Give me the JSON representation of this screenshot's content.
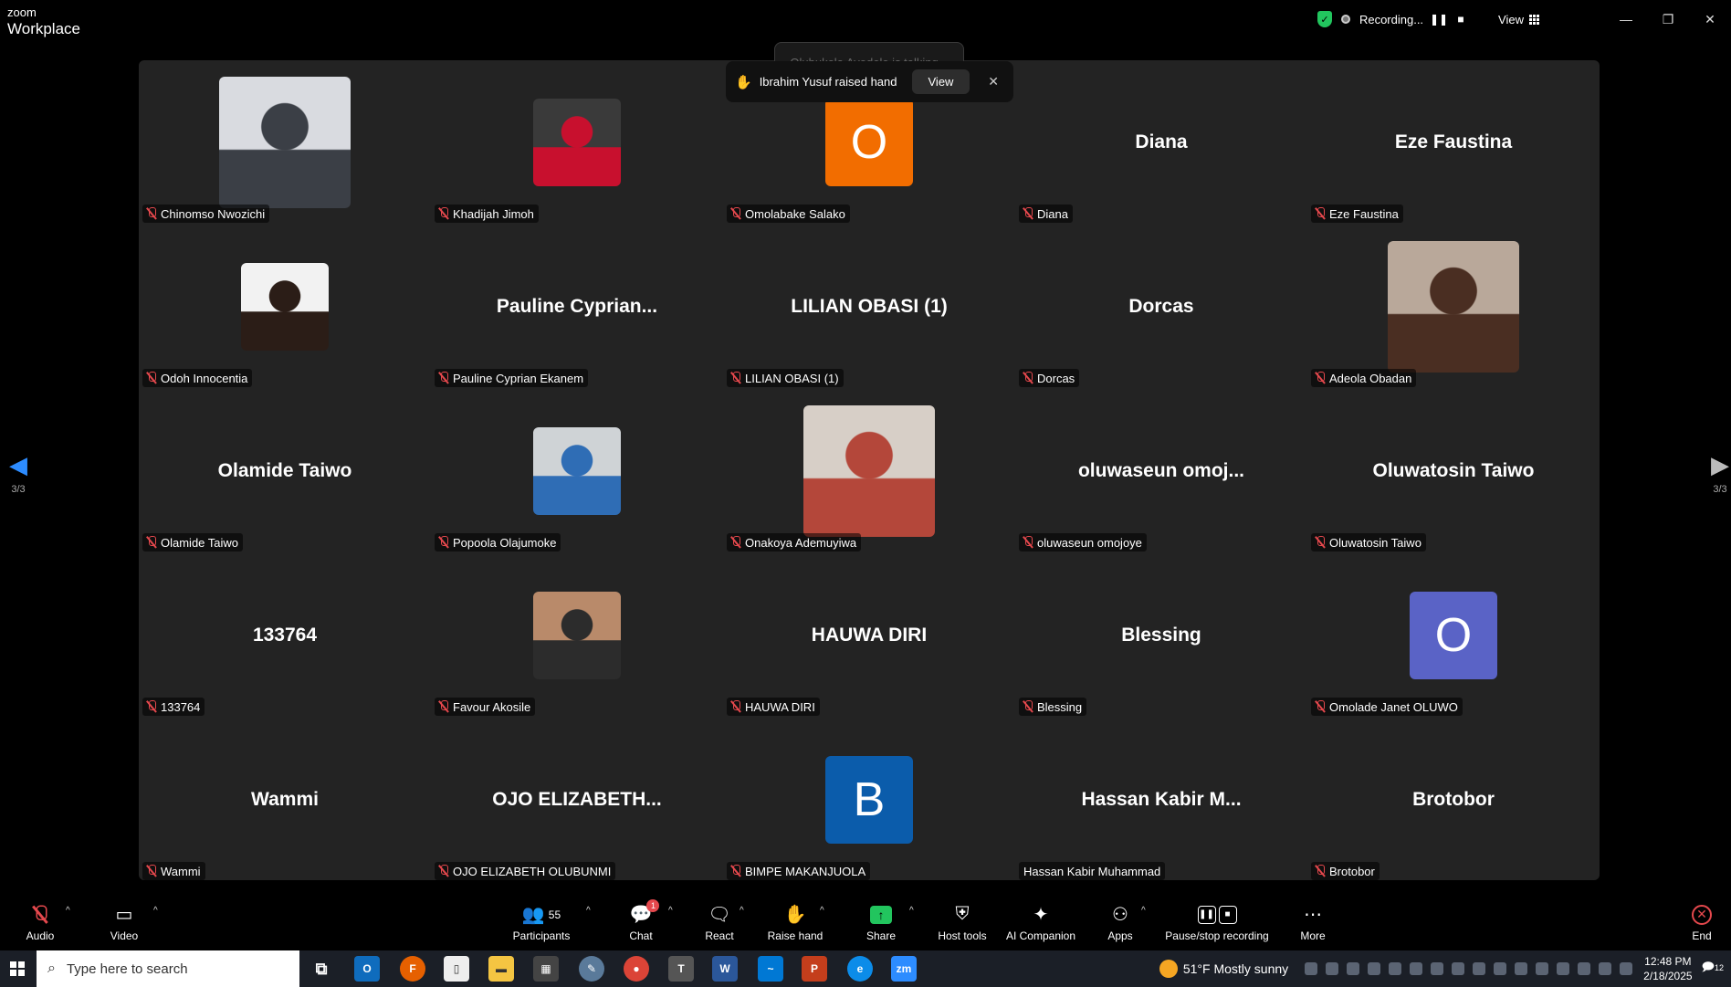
{
  "app": {
    "brand_small": "zoom",
    "brand_large": "Workplace"
  },
  "recording": {
    "label": "Recording...",
    "pause_glyph": "❚❚",
    "stop_glyph": "■"
  },
  "view_label": "View",
  "talking": "Olubukola Ayodele is talking...",
  "notification": {
    "text": "Ibrahim Yusuf raised hand",
    "view": "View",
    "close": "✕",
    "hand": "✋"
  },
  "pager": {
    "left": "3/3",
    "right": "3/3"
  },
  "tiles": [
    {
      "label": "Chinomso Nwozichi",
      "type": "photo",
      "big": true,
      "colors": [
        "#d9dbe0",
        "#3b3f46"
      ],
      "muted": true
    },
    {
      "label": "Khadijah Jimoh",
      "type": "photo",
      "colors": [
        "#3a3a3a",
        "#c8102e"
      ],
      "muted": true
    },
    {
      "label": "Omolabake Salako",
      "type": "letter",
      "letter": "O",
      "color": "#f26d00",
      "muted": true
    },
    {
      "label": "Diana",
      "type": "name",
      "display": "Diana",
      "muted": true
    },
    {
      "label": "Eze Faustina",
      "type": "name",
      "display": "Eze Faustina",
      "muted": true
    },
    {
      "label": "Odoh Innocentia",
      "type": "photo",
      "colors": [
        "#f2f2f2",
        "#2b1d17"
      ],
      "muted": true
    },
    {
      "label": "Pauline Cyprian Ekanem",
      "type": "name",
      "display": "Pauline  Cyprian...",
      "muted": true
    },
    {
      "label": "LILIAN OBASI (1)",
      "type": "name",
      "display": "LILIAN OBASI (1)",
      "muted": true
    },
    {
      "label": "Dorcas",
      "type": "name",
      "display": "Dorcas",
      "muted": true
    },
    {
      "label": "Adeola Obadan",
      "type": "photo",
      "big": true,
      "colors": [
        "#b9a89a",
        "#4a2e22"
      ],
      "muted": true
    },
    {
      "label": "Olamide Taiwo",
      "type": "name",
      "display": "Olamide Taiwo",
      "muted": true
    },
    {
      "label": "Popoola Olajumoke",
      "type": "photo",
      "colors": [
        "#cfd3d6",
        "#2f6db5"
      ],
      "muted": true
    },
    {
      "label": "Onakoya Ademuyiwa",
      "type": "photo",
      "big": true,
      "colors": [
        "#d7cfc7",
        "#b4473a"
      ],
      "muted": true
    },
    {
      "label": "oluwaseun omojoye",
      "type": "name",
      "display": "oluwaseun  omoj...",
      "muted": true
    },
    {
      "label": "Oluwatosin Taiwo",
      "type": "name",
      "display": "Oluwatosin Taiwo",
      "muted": true
    },
    {
      "label": "133764",
      "type": "name",
      "display": "133764",
      "muted": true
    },
    {
      "label": "Favour Akosile",
      "type": "photo",
      "colors": [
        "#b98a6a",
        "#2c2c2c"
      ],
      "muted": true
    },
    {
      "label": "HAUWA DIRI",
      "type": "name",
      "display": "HAUWA DIRI",
      "muted": true
    },
    {
      "label": "Blessing",
      "type": "name",
      "display": "Blessing",
      "muted": true
    },
    {
      "label": "Omolade Janet OLUWO",
      "type": "letter",
      "letter": "O",
      "color": "#5a63c6",
      "muted": true
    },
    {
      "label": "Wammi",
      "type": "name",
      "display": "Wammi",
      "muted": true
    },
    {
      "label": "OJO ELIZABETH OLUBUNMI",
      "type": "name",
      "display": "OJO  ELIZABETH...",
      "muted": true
    },
    {
      "label": "BIMPE MAKANJUOLA",
      "type": "letter",
      "letter": "B",
      "color": "#0b5cab",
      "muted": true
    },
    {
      "label": "Hassan Kabir Muhammad",
      "type": "name",
      "display": "Hassan Kabir M...",
      "muted": false
    },
    {
      "label": "Brotobor",
      "type": "name",
      "display": "Brotobor",
      "muted": true
    }
  ],
  "toolbar": {
    "audio": "Audio",
    "video": "Video",
    "participants": "Participants",
    "participants_count": "55",
    "chat": "Chat",
    "chat_badge": "1",
    "react": "React",
    "raise_hand": "Raise hand",
    "share": "Share",
    "host_tools": "Host tools",
    "ai_companion": "AI Companion",
    "apps": "Apps",
    "pause_stop": "Pause/stop recording",
    "more": "More",
    "end": "End"
  },
  "taskbar": {
    "search_placeholder": "Type here to search",
    "weather": "51°F  Mostly sunny",
    "time": "12:48 PM",
    "date": "2/18/2025",
    "notif_count": "12"
  }
}
